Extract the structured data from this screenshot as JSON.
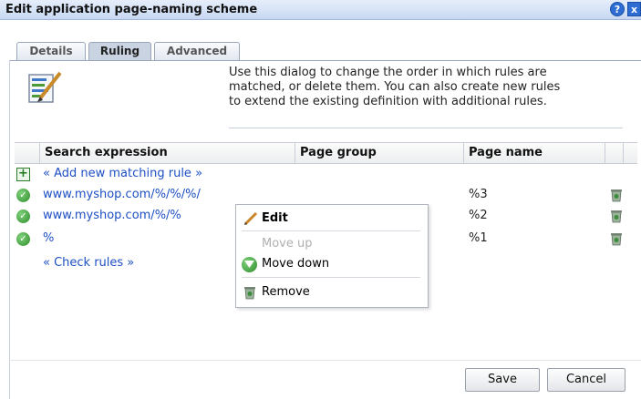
{
  "dialog": {
    "title": "Edit application page-naming scheme",
    "help_label": "?",
    "close_label": "x"
  },
  "tabs": [
    {
      "label": "Details"
    },
    {
      "label": "Ruling",
      "active": true
    },
    {
      "label": "Advanced"
    }
  ],
  "description": [
    "Use this dialog to change the order in which rules are",
    "matched, or delete them. You can also create new rules",
    "to extend the existing definition with additional rules."
  ],
  "table": {
    "headers": [
      "Search expression",
      "Page group",
      "Page name"
    ],
    "add_rule_label": "« Add new matching rule »",
    "rows": [
      {
        "expression": "www.myshop.com/%/%/%/",
        "page_group": "",
        "page_name": "%3"
      },
      {
        "expression": "www.myshop.com/%/%",
        "page_group": "",
        "page_name": "%2"
      },
      {
        "expression": "%",
        "page_group": "",
        "page_name": "%1"
      }
    ],
    "check_rules_label": "« Check rules »"
  },
  "context_menu": {
    "edit": "Edit",
    "move_up": "Move up",
    "move_down": "Move down",
    "remove": "Remove"
  },
  "footer": {
    "save": "Save",
    "cancel": "Cancel"
  },
  "colors": {
    "link": "#1d4fc4",
    "title_bar": "#c8d8f2",
    "ok_green": "#2e8b2a"
  }
}
